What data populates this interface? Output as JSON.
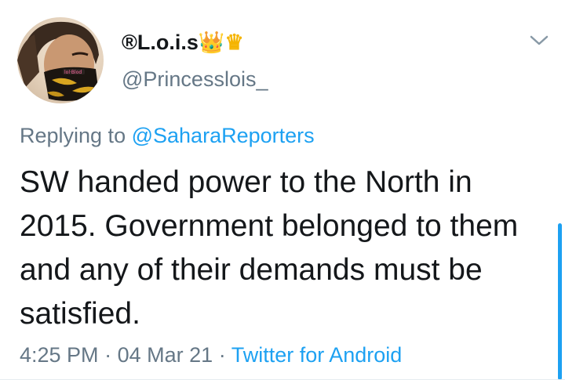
{
  "tweet": {
    "display_name": "®L.o.i.s",
    "name_emoji": "👑♛",
    "handle": "@Princesslois_",
    "replying_prefix": "Replying to",
    "replying_mention": "@SaharaReporters",
    "text": "SW handed power to the North in 2015. Government belonged to them and any of their demands must be satisfied.",
    "time": "4:25 PM",
    "separator": "·",
    "date": "04 Mar 21",
    "source": "Twitter for Android"
  },
  "icons": {
    "menu": "chevron-down-icon",
    "avatar": "profile-photo"
  },
  "colors": {
    "primary_text": "#14171a",
    "secondary_text": "#657786",
    "link": "#1da1f2",
    "crown": "#f5b400"
  }
}
